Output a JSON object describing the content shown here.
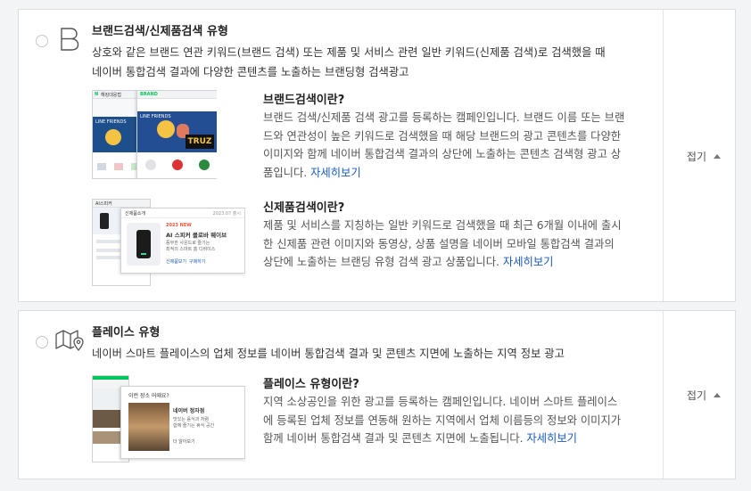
{
  "card1": {
    "title": "브랜드검색/신제품검색 유형",
    "desc_line1": "상호와 같은 브랜드 연관 키워드(브랜드 검색) 또는 제품 및 서비스 관련 일반 키워드(신제품 검색)로 검색했을 때",
    "desc_line2": "네이버 통합검색 결과에 다양한 콘텐츠를 노출하는 브랜딩형 검색광고",
    "fold_label": "접기",
    "icon": "letter-b-icon",
    "sections": [
      {
        "title": "브랜드검색이란?",
        "lines": [
          "브랜드 검색/신제품 검색 광고를 등록하는 캠페인입니다. 브랜드 이름 또는 브랜",
          "드와 연관성이 높은 키워드로 검색했을 때 해당 브랜드의 광고 콘텐츠를 다양한",
          "이미지와 함께 네이버 통합검색 결과의 상단에 노출하는 콘텐츠 검색형 광고 상",
          "품입니다."
        ],
        "link": "자세히보기",
        "thumb": {
          "logo": "N",
          "left_header": "해킹대응법",
          "left_label": "LINE FRIENDS",
          "right_header": "BRAND",
          "right_label": "LINE FRIENDS",
          "banner_text": "TRUZ"
        }
      },
      {
        "title": "신제품검색이란?",
        "lines": [
          "제품 및 서비스를 지칭하는 일반 키워드로 검색했을 때 최근 6개월 이내에 출시",
          "한 신제품 관련 이미지와 동영상, 상품 설명을 네이버 모바일 통합검색 결과의",
          "상단에 노출하는 브랜딩 유형 검색 광고 상품입니다."
        ],
        "link": "자세히보기",
        "thumb": {
          "left_header": "AI스피커",
          "card_header": "신제품소개",
          "card_date": "2023.07 출시",
          "card_badge": "2023 NEW",
          "card_title": "AI 스피커 클로바 웨이브",
          "card_sub1": "풍부한 사운드로 즐기는",
          "card_sub2": "최적의 스마트 홈 디바이스",
          "btn1": "신제품보기",
          "btn2": "구매하기"
        }
      }
    ]
  },
  "card2": {
    "title": "플레이스 유형",
    "desc": "네이버 스마트 플레이스의 업체 정보를 네이버 통합검색 결과 및 콘텐츠 지면에 노출하는 지역 정보 광고",
    "fold_label": "접기",
    "icon": "map-pin-icon",
    "section": {
      "title": "플레이스 유형이란?",
      "lines": [
        "지역 소상공인을 위한 광고를 등록하는 캠페인입니다. 네이버 스마트 플레이스",
        "에 등록된 업체 정보를 연동해 원하는 지역에서 업체 이름등의 정보와 이미지가",
        "함께 네이버 통합검색 결과 및 콘텐츠 지면에 노출됩니다."
      ],
      "link": "자세히보기",
      "thumb": {
        "header": "이런 장소 어때요?",
        "name": "네이버 정자점",
        "line1": "맛있는 음식과 저렴",
        "line2": "함께 즐기는 휴식 공간",
        "more": "더 알아보기"
      }
    }
  },
  "colors": {
    "link": "#1a5bbd",
    "naver_green": "#03c75a",
    "border": "#dcdde0"
  }
}
